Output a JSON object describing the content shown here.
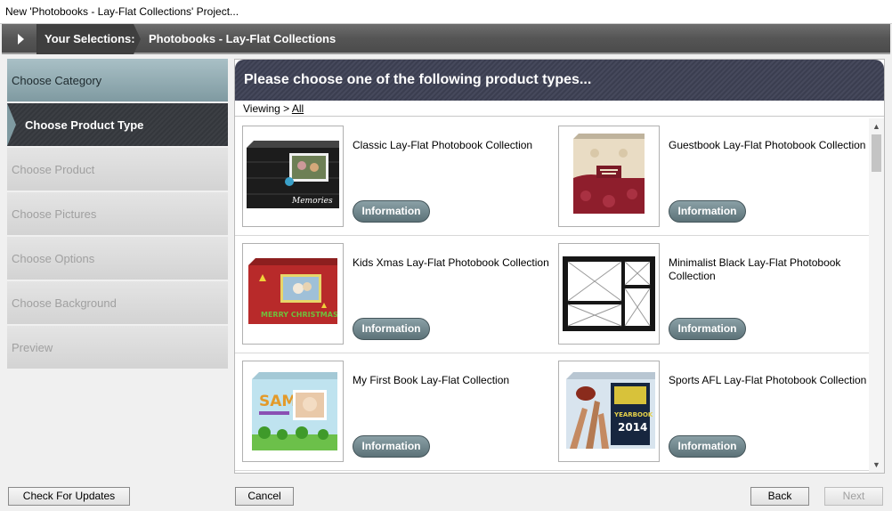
{
  "window": {
    "title": "New 'Photobooks - Lay-Flat Collections' Project..."
  },
  "crumbs": {
    "label": "Your Selections:",
    "path": "Photobooks - Lay-Flat Collections"
  },
  "steps": [
    {
      "label": "Choose Category",
      "state": "done"
    },
    {
      "label": "Choose Product Type",
      "state": "current"
    },
    {
      "label": "Choose Product",
      "state": "pending"
    },
    {
      "label": "Choose Pictures",
      "state": "pending"
    },
    {
      "label": "Choose Options",
      "state": "pending"
    },
    {
      "label": "Choose Background",
      "state": "pending"
    },
    {
      "label": "Preview",
      "state": "pending"
    }
  ],
  "main": {
    "heading": "Please choose one of the following product types...",
    "viewing_prefix": "Viewing >",
    "viewing_link": "All"
  },
  "info_label": "Information",
  "products": [
    {
      "title": "Classic Lay-Flat Photobook Collection",
      "thumb": "classic-photobook-image"
    },
    {
      "title": "Guestbook Lay-Flat Photobook Collection",
      "thumb": "guestbook-photobook-image"
    },
    {
      "title": "Kids Xmas Lay-Flat Photobook Collection",
      "thumb": "kids-xmas-photobook-image"
    },
    {
      "title": "Minimalist Black Lay-Flat Photobook Collection",
      "thumb": "minimalist-black-photobook-image"
    },
    {
      "title": "My First Book Lay-Flat Collection",
      "thumb": "my-first-book-image"
    },
    {
      "title": "Sports AFL Lay-Flat Photobook Collection",
      "thumb": "sports-afl-photobook-image"
    }
  ],
  "thumb_text": {
    "classic_script": "Memories",
    "xmas": "MERRY CHRISTMAS",
    "sam": "SAM",
    "yearbook": "YEARBOOK",
    "year": "2014"
  },
  "buttons": {
    "check_updates": "Check For Updates",
    "cancel": "Cancel",
    "back": "Back",
    "next": "Next"
  },
  "colors": {
    "header_dark": "#3b3e50",
    "step_done": "#7f9aa1",
    "info_button": "#5c7278"
  }
}
